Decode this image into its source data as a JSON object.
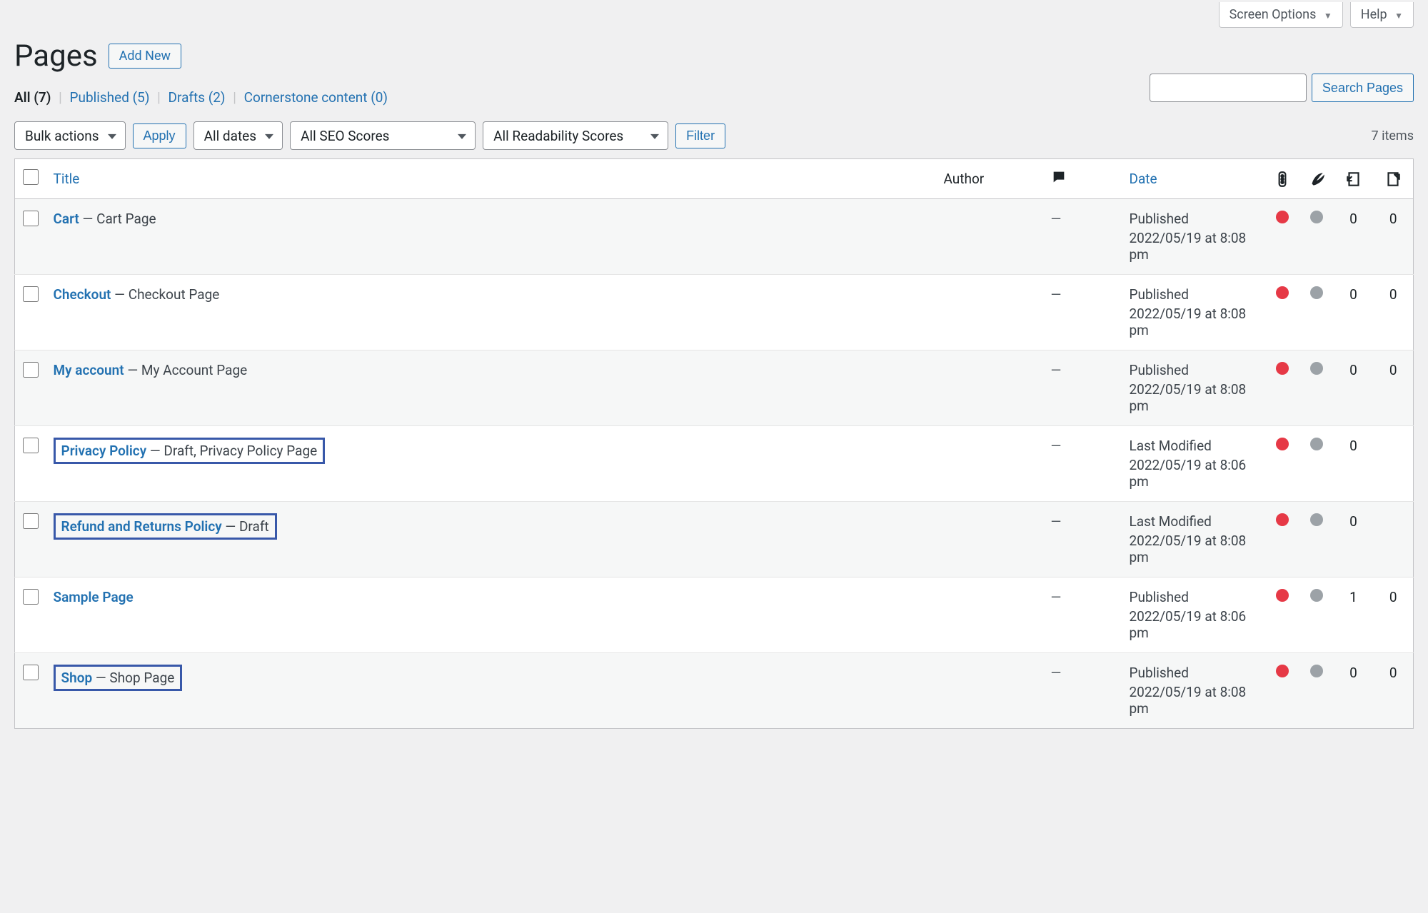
{
  "topTabs": {
    "screenOptions": "Screen Options",
    "help": "Help"
  },
  "header": {
    "title": "Pages",
    "addNew": "Add New"
  },
  "subsub": {
    "all_label": "All",
    "all_count": "(7)",
    "published_label": "Published",
    "published_count": "(5)",
    "drafts_label": "Drafts",
    "drafts_count": "(2)",
    "cornerstone_label": "Cornerstone content",
    "cornerstone_count": "(0)"
  },
  "search": {
    "button": "Search Pages"
  },
  "filters": {
    "bulkActions": "Bulk actions",
    "apply": "Apply",
    "allDates": "All dates",
    "allSeo": "All SEO Scores",
    "allReadability": "All Readability Scores",
    "filter": "Filter",
    "itemsCount": "7 items"
  },
  "columns": {
    "title": "Title",
    "author": "Author",
    "date": "Date"
  },
  "rows": [
    {
      "title": "Cart",
      "suffix": " — Cart Page",
      "highlighted": false,
      "comments": "—",
      "dateStatus": "Published",
      "dateText": "2022/05/19 at 8:08 pm",
      "seoDot": "red",
      "readDot": "gray",
      "linksIn": "0",
      "linksOut": "0"
    },
    {
      "title": "Checkout",
      "suffix": " — Checkout Page",
      "highlighted": false,
      "comments": "—",
      "dateStatus": "Published",
      "dateText": "2022/05/19 at 8:08 pm",
      "seoDot": "red",
      "readDot": "gray",
      "linksIn": "0",
      "linksOut": "0"
    },
    {
      "title": "My account",
      "suffix": " — My Account Page",
      "highlighted": false,
      "comments": "—",
      "dateStatus": "Published",
      "dateText": "2022/05/19 at 8:08 pm",
      "seoDot": "red",
      "readDot": "gray",
      "linksIn": "0",
      "linksOut": "0"
    },
    {
      "title": "Privacy Policy",
      "suffix": " — Draft, Privacy Policy Page",
      "highlighted": true,
      "comments": "—",
      "dateStatus": "Last Modified",
      "dateText": "2022/05/19 at 8:06 pm",
      "seoDot": "red",
      "readDot": "gray",
      "linksIn": "0",
      "linksOut": ""
    },
    {
      "title": "Refund and Returns Policy",
      "suffix": " — Draft",
      "highlighted": true,
      "comments": "—",
      "dateStatus": "Last Modified",
      "dateText": "2022/05/19 at 8:08 pm",
      "seoDot": "red",
      "readDot": "gray",
      "linksIn": "0",
      "linksOut": ""
    },
    {
      "title": "Sample Page",
      "suffix": "",
      "highlighted": false,
      "comments": "—",
      "dateStatus": "Published",
      "dateText": "2022/05/19 at 8:06 pm",
      "seoDot": "red",
      "readDot": "gray",
      "linksIn": "1",
      "linksOut": "0"
    },
    {
      "title": "Shop",
      "suffix": " — Shop Page",
      "highlighted": true,
      "comments": "—",
      "dateStatus": "Published",
      "dateText": "2022/05/19 at 8:08 pm",
      "seoDot": "red",
      "readDot": "gray",
      "linksIn": "0",
      "linksOut": "0"
    }
  ]
}
